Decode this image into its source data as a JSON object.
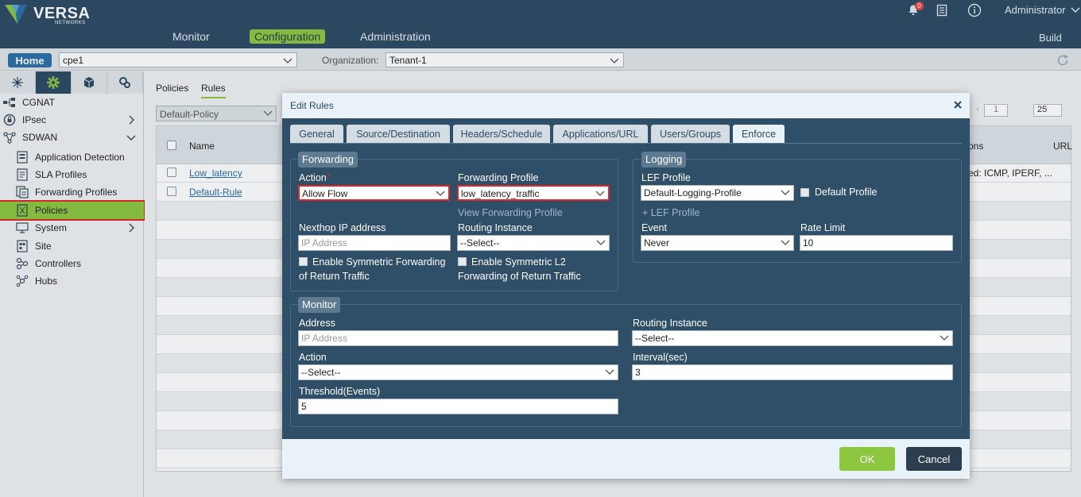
{
  "brand": {
    "name": "VERSA",
    "sub": "NETWORKS"
  },
  "top_nav": {
    "items": [
      {
        "label": "Monitor",
        "active": false
      },
      {
        "label": "Configuration",
        "active": true
      },
      {
        "label": "Administration",
        "active": false
      }
    ]
  },
  "notifications": {
    "count": "0"
  },
  "user": {
    "name": "Administrator"
  },
  "build_label": "Build",
  "bar2": {
    "home_label": "Home",
    "device": "cpe1",
    "org_label": "Organization:",
    "org_value": "Tenant-1"
  },
  "sidebar": {
    "items": [
      {
        "label": "CGNAT",
        "icon": "cgnat-icon"
      },
      {
        "label": "IPsec",
        "icon": "ipsec-icon"
      },
      {
        "label": "SDWAN",
        "icon": "sdwan-icon"
      },
      {
        "label": "Application Detection",
        "icon": "app-detection-icon"
      },
      {
        "label": "SLA Profiles",
        "icon": "sla-profiles-icon"
      },
      {
        "label": "Forwarding Profiles",
        "icon": "forwarding-profiles-icon"
      },
      {
        "label": "Policies",
        "icon": "policies-icon"
      },
      {
        "label": "System",
        "icon": "system-icon"
      },
      {
        "label": "Site",
        "icon": "site-icon"
      },
      {
        "label": "Controllers",
        "icon": "controllers-icon"
      },
      {
        "label": "Hubs",
        "icon": "hubs-icon"
      }
    ]
  },
  "main": {
    "tabs": [
      "Policies",
      "Rules"
    ],
    "policy_select": "Default-Policy",
    "table": {
      "headers": [
        "Name",
        "ons",
        "URL"
      ],
      "rows": [
        {
          "name": "Low_latency",
          "extra": "ed: ICMP, IPERF, ..."
        },
        {
          "name": "Default-Rule",
          "extra": ""
        }
      ]
    },
    "pager": {
      "page": "1",
      "page_size": "25"
    }
  },
  "modal": {
    "title": "Edit Rules",
    "tabs": [
      "General",
      "Source/Destination",
      "Headers/Schedule",
      "Applications/URL",
      "Users/Groups",
      "Enforce"
    ],
    "active_tab": "Enforce",
    "forwarding": {
      "legend": "Forwarding",
      "action_label": "Action",
      "action_value": "Allow Flow",
      "fwd_profile_label": "Forwarding Profile",
      "fwd_profile_value": "low_latency_traffic",
      "view_fwd_profile": "View Forwarding Profile",
      "nexthop_label": "Nexthop IP address",
      "nexthop_placeholder": "IP Address",
      "routing_instance_label": "Routing Instance",
      "routing_instance_value": "--Select--",
      "sym_fwd_line1": "Enable Symmetric Forwarding",
      "sym_fwd_line2": "of Return Traffic",
      "sym_l2_line1": "Enable Symmetric L2",
      "sym_l2_line2": "Forwarding of Return Traffic"
    },
    "logging": {
      "legend": "Logging",
      "lef_profile_label": "LEF Profile",
      "lef_profile_value": "Default-Logging-Profile",
      "default_profile_label": "Default Profile",
      "add_lef_profile": "+ LEF Profile",
      "event_label": "Event",
      "event_value": "Never",
      "rate_limit_label": "Rate Limit",
      "rate_limit_value": "10"
    },
    "monitor": {
      "legend": "Monitor",
      "address_label": "Address",
      "address_placeholder": "IP Address",
      "routing_instance_label": "Routing Instance",
      "routing_instance_value": "--Select--",
      "action_label": "Action",
      "action_value": "--Select--",
      "interval_label": "Interval(sec)",
      "interval_value": "3",
      "threshold_label": "Threshold(Events)",
      "threshold_value": "5"
    },
    "ok_label": "OK",
    "cancel_label": "Cancel"
  }
}
